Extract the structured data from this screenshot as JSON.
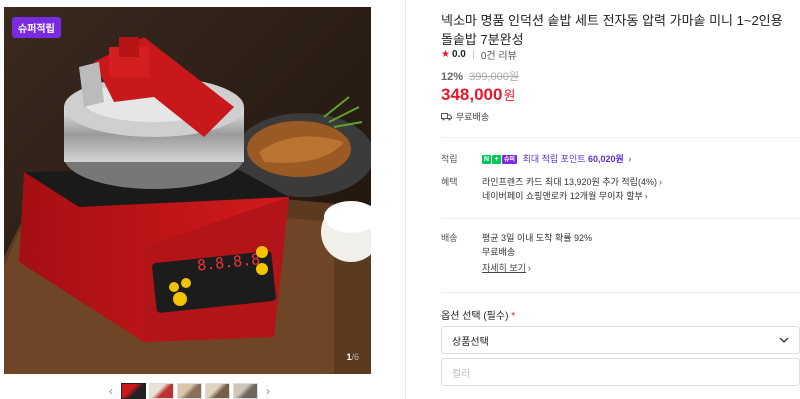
{
  "gallery": {
    "badge": "슈퍼적립",
    "counter_current": "1",
    "counter_total": "/6",
    "prev_arrow": "‹",
    "next_arrow": "›",
    "thumbnail_count": 5
  },
  "product": {
    "title": "넥소마 명품 인덕션 솥밥 세트 전자동 압력 가마솥 미니 1~2인용 돌솥밥 7분완성",
    "rating": "0.0",
    "review_count": "0건 리뷰",
    "discount_rate": "12%",
    "original_price": "399,000원",
    "price": "348,000",
    "price_unit": "원",
    "free_shipping": "무료배송"
  },
  "details": {
    "points": {
      "label": "적립",
      "badge_n": "N",
      "badge_plus": "+",
      "badge_super": "슈퍼",
      "text_prefix": "최대 적립 포인트 ",
      "amount": "60,020원"
    },
    "benefits": {
      "label": "혜택",
      "line1": "라인프렌즈 카드 최대 13,920원 추가 적립(4%)",
      "line2": "네이버페이 쇼핑앤로카 12개월 무이자 할부"
    },
    "delivery": {
      "label": "배송",
      "line1": "평균 3일 이내 도착 확률 92%",
      "line2": "무료배송",
      "more_link": "자세히 보기"
    }
  },
  "options": {
    "label": "옵션 선택 (필수)",
    "required_mark": "*",
    "select1": "상품선택",
    "select2": "컬러",
    "caret": "⌄"
  },
  "colors": {
    "accent_red": "#e5192e",
    "super_purple": "#7a2ae0",
    "npay_green": "#03c75a"
  }
}
